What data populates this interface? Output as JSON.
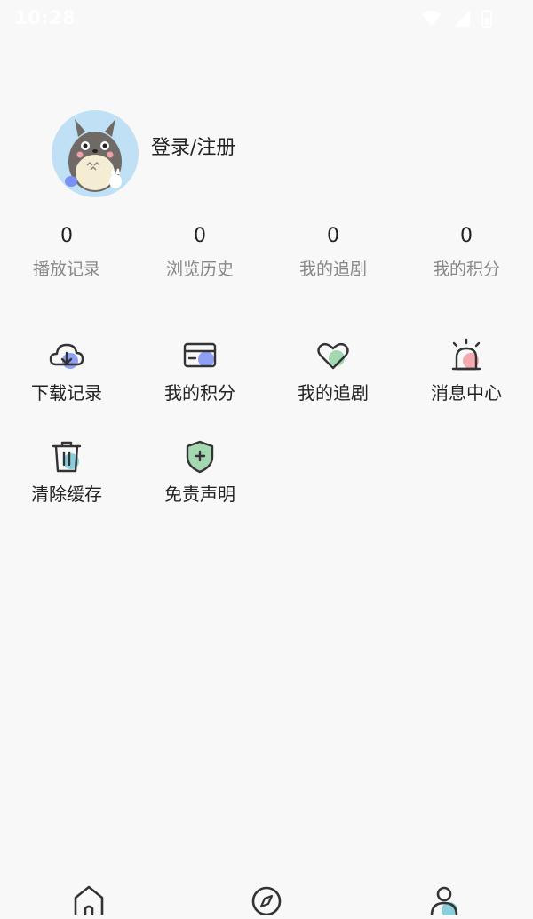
{
  "status_bar": {
    "time": "10:28"
  },
  "profile": {
    "login_label": "登录/注册"
  },
  "stats": [
    {
      "value": "0",
      "label": "播放记录"
    },
    {
      "value": "0",
      "label": "浏览历史"
    },
    {
      "value": "0",
      "label": "我的追剧"
    },
    {
      "value": "0",
      "label": "我的积分"
    }
  ],
  "menu": [
    {
      "label": "下载记录",
      "icon": "cloud-download-icon",
      "accent": "#7b8ff5"
    },
    {
      "label": "我的积分",
      "icon": "card-icon",
      "accent": "#7b8ff5"
    },
    {
      "label": "我的追剧",
      "icon": "heart-icon",
      "accent": "#9ad4a8"
    },
    {
      "label": "消息中心",
      "icon": "alarm-icon",
      "accent": "#f2a0a6"
    },
    {
      "label": "清除缓存",
      "icon": "trash-icon",
      "accent": "#7cc9d6"
    },
    {
      "label": "免责声明",
      "icon": "shield-plus-icon",
      "accent": "#9ad4a8"
    }
  ],
  "tabbar": [
    {
      "icon": "home-icon"
    },
    {
      "icon": "compass-icon"
    },
    {
      "icon": "person-icon"
    }
  ]
}
